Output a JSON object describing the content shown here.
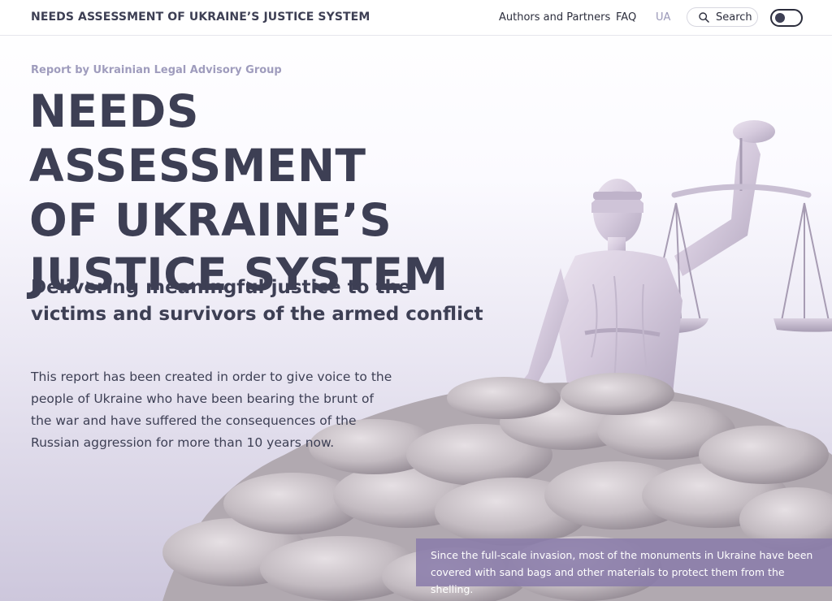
{
  "header": {
    "brand": "NEEDS ASSESSMENT OF UKRAINE’S JUSTICE SYSTEM",
    "nav": {
      "authors": "Authors and Partners",
      "faq": "FAQ",
      "lang": "UA"
    },
    "search_label": "Search",
    "theme_toggle_on": false
  },
  "hero": {
    "kicker": "Report by Ukrainian Legal Advisory Group",
    "title_lines": [
      "NEEDS ASSESSMENT",
      "OF UKRAINE’S",
      "JUSTICE SYSTEM"
    ],
    "subtitle": "Delivering meaningful justice to the victims and survivors of the armed conflict",
    "body": "This report has been created in order to give voice to the people of Ukraine who have been bearing the brunt of the war and have suffered the consequences of the Russian aggression for more than 10 years now.",
    "caption": "Since the full-scale invasion, most of the monuments in Ukraine have been covered with sand bags and other materials to protect them from the shelling."
  },
  "colors": {
    "text": "#3d3f54",
    "kicker": "#9f9cbd",
    "lang": "#9a98b8",
    "caption_bg": "#8a7caa",
    "statue": "#d8cfe0",
    "sandbags": "#bdb6bc"
  },
  "icons": {
    "search": "search-icon",
    "statue": "justice-statue-illustration"
  }
}
